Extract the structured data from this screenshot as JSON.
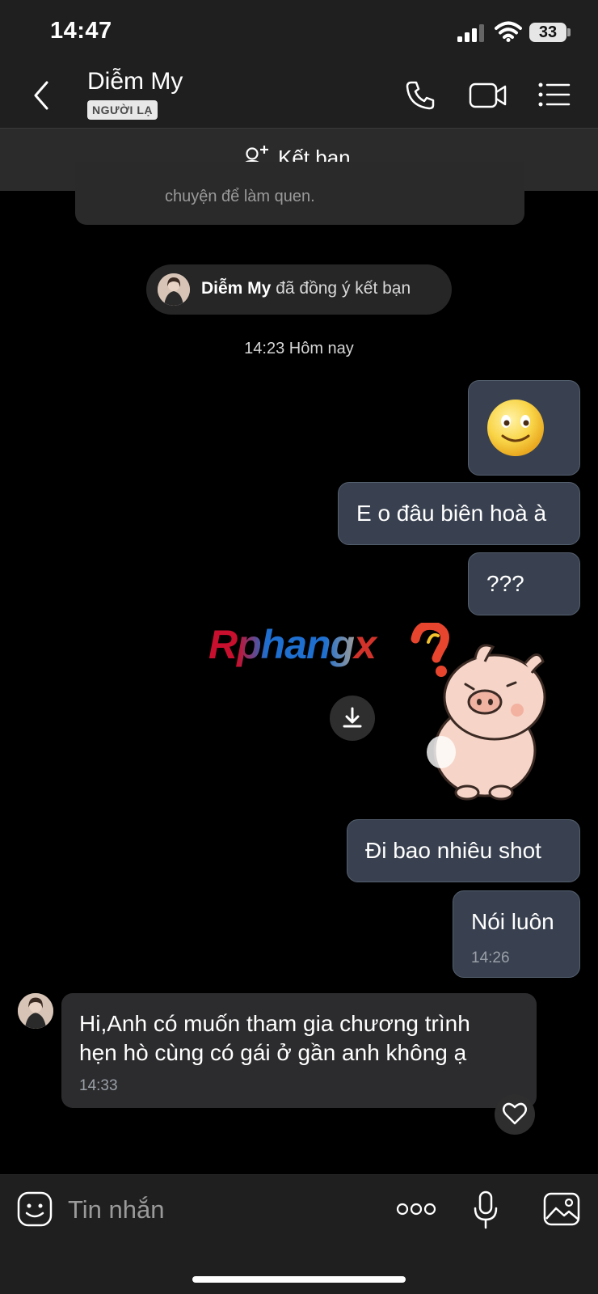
{
  "status_bar": {
    "time": "14:47",
    "battery": "33"
  },
  "header": {
    "contact_name": "Diễm My",
    "badge": "NGƯỜI LẠ"
  },
  "add_friend": {
    "label": "Kết bạn"
  },
  "intro_card": {
    "text": "chuyện để làm quen."
  },
  "system_message": {
    "name": "Diễm My",
    "text": "đã đồng ý kết bạn"
  },
  "divider": {
    "time": "14:23 Hôm nay"
  },
  "messages": [
    {
      "direction": "out",
      "type": "emoji",
      "emoji": "🙂"
    },
    {
      "direction": "out",
      "text": "E o đâu biên hoà à"
    },
    {
      "direction": "out",
      "text": "???"
    },
    {
      "direction": "out",
      "type": "sticker",
      "sticker": "pig-question-sticker"
    },
    {
      "direction": "out",
      "text": "Đi bao nhiêu shot"
    },
    {
      "direction": "out",
      "text": "Nói luôn",
      "time": "14:26"
    },
    {
      "direction": "in",
      "lines": [
        "Hi,Anh có muốn tham gia chương trình",
        "hẹn hò cùng có gái ở gần anh không ạ"
      ],
      "time": "14:33"
    }
  ],
  "watermark": {
    "text_main": "Rphang",
    "text_x": "x"
  },
  "input": {
    "placeholder": "Tin nhắn"
  },
  "colors": {
    "outgoing_bubble": "#394150",
    "incoming_bubble": "#2c2c2e",
    "header_bg": "#1f1f1f"
  }
}
